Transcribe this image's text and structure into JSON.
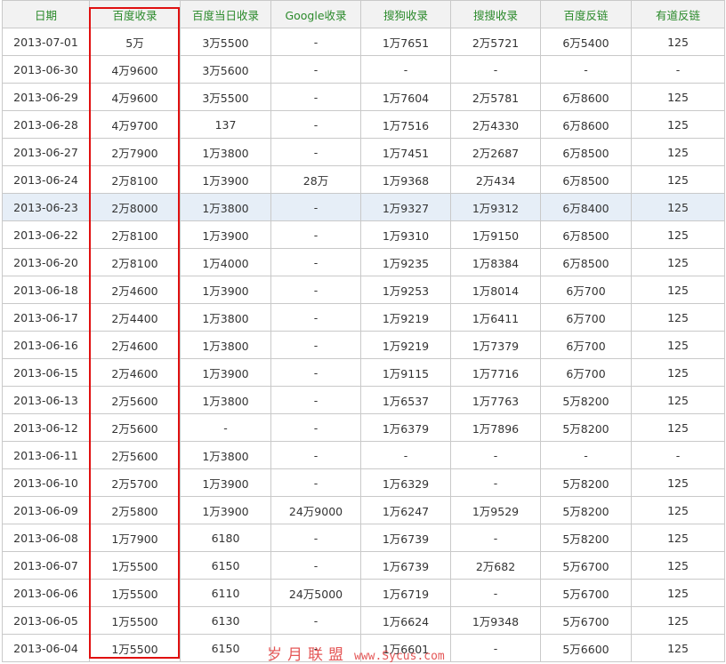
{
  "table": {
    "headers": [
      "日期",
      "百度收录",
      "百度当日收录",
      "Google收录",
      "搜狗收录",
      "搜搜收录",
      "百度反链",
      "有道反链"
    ],
    "highlight_date": "2013-06-23",
    "rows": [
      [
        "2013-07-01",
        "5万",
        "3万5500",
        "-",
        "1万7651",
        "2万5721",
        "6万5400",
        "125"
      ],
      [
        "2013-06-30",
        "4万9600",
        "3万5600",
        "-",
        "-",
        "-",
        "-",
        "-"
      ],
      [
        "2013-06-29",
        "4万9600",
        "3万5500",
        "-",
        "1万7604",
        "2万5781",
        "6万8600",
        "125"
      ],
      [
        "2013-06-28",
        "4万9700",
        "137",
        "-",
        "1万7516",
        "2万4330",
        "6万8600",
        "125"
      ],
      [
        "2013-06-27",
        "2万7900",
        "1万3800",
        "-",
        "1万7451",
        "2万2687",
        "6万8500",
        "125"
      ],
      [
        "2013-06-24",
        "2万8100",
        "1万3900",
        "28万",
        "1万9368",
        "2万434",
        "6万8500",
        "125"
      ],
      [
        "2013-06-23",
        "2万8000",
        "1万3800",
        "-",
        "1万9327",
        "1万9312",
        "6万8400",
        "125"
      ],
      [
        "2013-06-22",
        "2万8100",
        "1万3900",
        "-",
        "1万9310",
        "1万9150",
        "6万8500",
        "125"
      ],
      [
        "2013-06-20",
        "2万8100",
        "1万4000",
        "-",
        "1万9235",
        "1万8384",
        "6万8500",
        "125"
      ],
      [
        "2013-06-18",
        "2万4600",
        "1万3900",
        "-",
        "1万9253",
        "1万8014",
        "6万700",
        "125"
      ],
      [
        "2013-06-17",
        "2万4400",
        "1万3800",
        "-",
        "1万9219",
        "1万6411",
        "6万700",
        "125"
      ],
      [
        "2013-06-16",
        "2万4600",
        "1万3800",
        "-",
        "1万9219",
        "1万7379",
        "6万700",
        "125"
      ],
      [
        "2013-06-15",
        "2万4600",
        "1万3900",
        "-",
        "1万9115",
        "1万7716",
        "6万700",
        "125"
      ],
      [
        "2013-06-13",
        "2万5600",
        "1万3800",
        "-",
        "1万6537",
        "1万7763",
        "5万8200",
        "125"
      ],
      [
        "2013-06-12",
        "2万5600",
        "-",
        "-",
        "1万6379",
        "1万7896",
        "5万8200",
        "125"
      ],
      [
        "2013-06-11",
        "2万5600",
        "1万3800",
        "-",
        "-",
        "-",
        "-",
        "-"
      ],
      [
        "2013-06-10",
        "2万5700",
        "1万3900",
        "-",
        "1万6329",
        "-",
        "5万8200",
        "125"
      ],
      [
        "2013-06-09",
        "2万5800",
        "1万3900",
        "24万9000",
        "1万6247",
        "1万9529",
        "5万8200",
        "125"
      ],
      [
        "2013-06-08",
        "1万7900",
        "6180",
        "-",
        "1万6739",
        "-",
        "5万8200",
        "125"
      ],
      [
        "2013-06-07",
        "1万5500",
        "6150",
        "-",
        "1万6739",
        "2万682",
        "5万6700",
        "125"
      ],
      [
        "2013-06-06",
        "1万5500",
        "6110",
        "24万5000",
        "1万6719",
        "-",
        "5万6700",
        "125"
      ],
      [
        "2013-06-05",
        "1万5500",
        "6130",
        "-",
        "1万6624",
        "1万9348",
        "5万6700",
        "125"
      ],
      [
        "2013-06-04",
        "1万5500",
        "6150",
        "-",
        "1万6601",
        "-",
        "5万6600",
        "125"
      ]
    ]
  },
  "watermark": {
    "text": "岁月联盟",
    "url": "www.Sycus.com"
  },
  "colors": {
    "header_text": "#2b8a2b",
    "highlight_row": "#e6eef7",
    "annotation_box": "#e01010",
    "border": "#c9c9c9"
  }
}
